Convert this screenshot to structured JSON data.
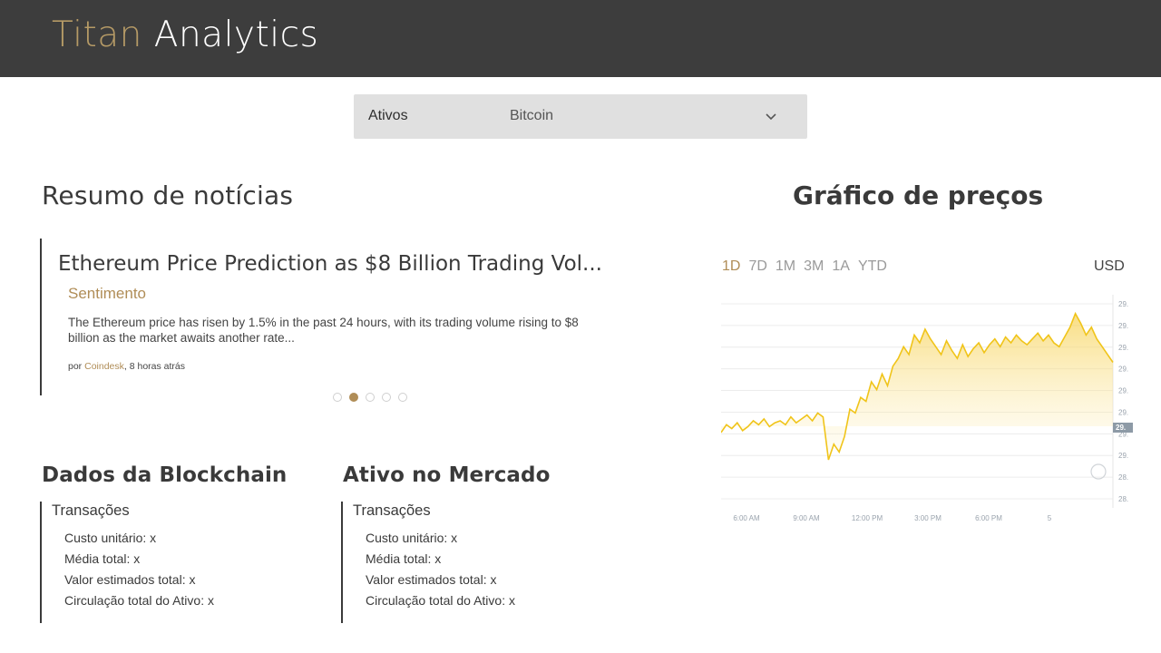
{
  "header": {
    "brand_part1": "Titan",
    "brand_part2": "Analytics",
    "brand_gold": "#b59a66",
    "bg": "#3d3d3d"
  },
  "asset_selector": {
    "label": "Ativos",
    "value": "Bitcoin",
    "icon": "chevron-down-icon"
  },
  "news": {
    "section_title": "Resumo de notícias",
    "headline": "Ethereum Price Prediction as $8 Billion Trading Vol...",
    "sentiment_label": "Sentimento",
    "summary": "The Ethereum price has risen by 1.5% in the past 24 hours, with its trading volume rising to $8 billion as the market awaits another rate...",
    "by": "por",
    "source": "Coindesk",
    "time": ", 8 horas atrás",
    "pagination_count": 5,
    "active_page": 2
  },
  "blockchain": {
    "title": "Dados da Blockchain",
    "subtitle": "Transações",
    "rows": [
      "Custo unitário: x",
      "Média total: x",
      "Valor estimados total: x",
      "Circulação total do Ativo: x"
    ]
  },
  "market": {
    "title": "Ativo no Mercado",
    "subtitle": "Transações",
    "rows": [
      "Custo unitário: x",
      "Média total: x",
      "Valor estimados total: x",
      "Circulação total do Ativo: x"
    ]
  },
  "price_chart": {
    "title": "Gráfico de preços",
    "ranges": [
      "1D",
      "7D",
      "1M",
      "3M",
      "1A",
      "YTD"
    ],
    "active_range": "1D",
    "currency": "USD",
    "line_color": "#f0c419",
    "fill_color": "#fbe9a6"
  },
  "chart_data": {
    "type": "area",
    "title": "",
    "xlabel": "",
    "ylabel": "",
    "x_ticks": [
      "6:00 AM",
      "9:00 AM",
      "12:00 PM",
      "3:00 PM",
      "6:00 PM",
      "5"
    ],
    "y_ticks": [
      "29.",
      "29.",
      "29.",
      "29.",
      "29.",
      "29.",
      "29.",
      "29.",
      "28.",
      "28."
    ],
    "current_price_label": "29.",
    "grid": true,
    "series": [
      {
        "values": [
          0.34,
          0.38,
          0.36,
          0.39,
          0.35,
          0.37,
          0.4,
          0.38,
          0.41,
          0.37,
          0.39,
          0.4,
          0.38,
          0.42,
          0.39,
          0.41,
          0.43,
          0.4,
          0.44,
          0.42,
          0.2,
          0.28,
          0.24,
          0.32,
          0.46,
          0.44,
          0.52,
          0.5,
          0.6,
          0.56,
          0.64,
          0.58,
          0.68,
          0.72,
          0.78,
          0.74,
          0.84,
          0.8,
          0.87,
          0.82,
          0.78,
          0.74,
          0.81,
          0.76,
          0.72,
          0.79,
          0.73,
          0.77,
          0.8,
          0.75,
          0.79,
          0.82,
          0.78,
          0.83,
          0.8,
          0.84,
          0.81,
          0.79,
          0.82,
          0.85,
          0.81,
          0.84,
          0.8,
          0.78,
          0.83,
          0.88,
          0.95,
          0.9,
          0.84,
          0.88,
          0.82,
          0.78,
          0.74,
          0.7
        ]
      }
    ]
  }
}
